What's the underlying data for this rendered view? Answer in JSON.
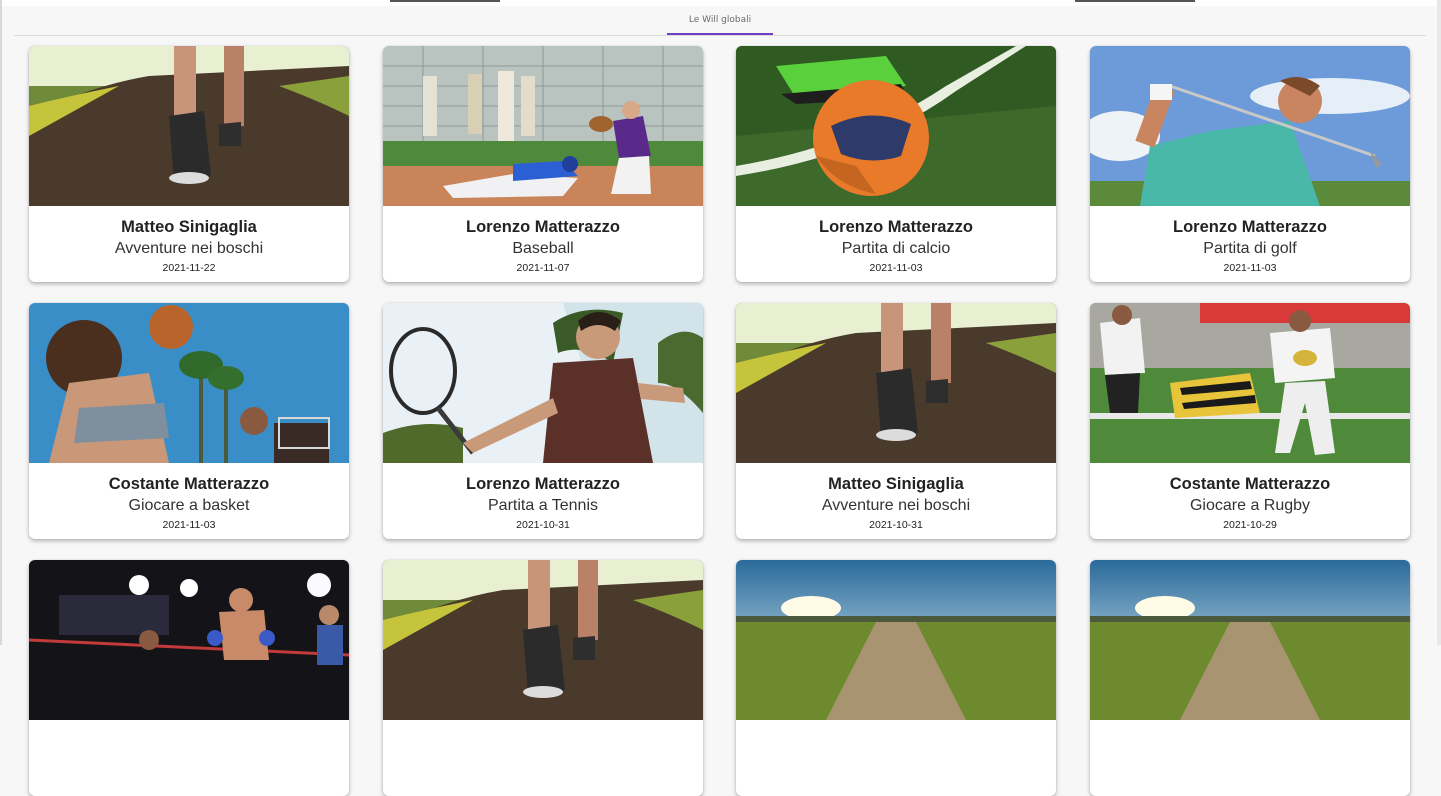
{
  "tabs": [
    {
      "label": "Le Will globali",
      "active": true
    }
  ],
  "accent_color": "#6a3fc2",
  "cards": [
    {
      "author": "Matteo Sinigaglia",
      "activity": "Avventure nei boschi",
      "date": "2021-11-22",
      "image": "forest-path-walking-photo"
    },
    {
      "author": "Lorenzo Matterazzo",
      "activity": "Baseball",
      "date": "2021-11-07",
      "image": "baseball-slide-photo"
    },
    {
      "author": "Lorenzo Matterazzo",
      "activity": "Partita di calcio",
      "date": "2021-11-03",
      "image": "soccer-ball-photo"
    },
    {
      "author": "Lorenzo Matterazzo",
      "activity": "Partita di golf",
      "date": "2021-11-03",
      "image": "golf-swing-photo"
    },
    {
      "author": "Costante Matterazzo",
      "activity": "Giocare a basket",
      "date": "2021-11-03",
      "image": "basketball-shot-photo"
    },
    {
      "author": "Lorenzo Matterazzo",
      "activity": "Partita a Tennis",
      "date": "2021-10-31",
      "image": "tennis-player-photo"
    },
    {
      "author": "Matteo Sinigaglia",
      "activity": "Avventure nei boschi",
      "date": "2021-10-31",
      "image": "forest-path-walking-photo"
    },
    {
      "author": "Costante Matterazzo",
      "activity": "Giocare a Rugby",
      "date": "2021-10-29",
      "image": "rugby-tackle-photo"
    },
    {
      "image": "boxing-ring-photo"
    },
    {
      "image": "forest-path-walking-photo"
    },
    {
      "image": "field-sunrise-photo"
    },
    {
      "image": "field-sunrise-photo"
    }
  ]
}
